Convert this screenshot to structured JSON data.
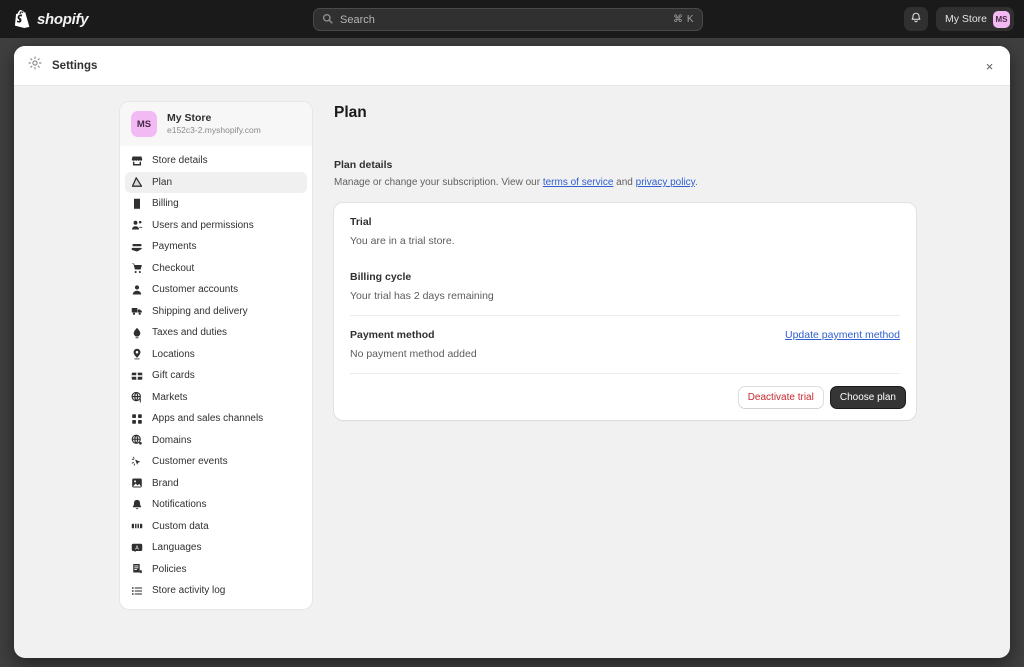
{
  "topbar": {
    "brand": "shopify",
    "brand_icon": "shopify-bag-icon",
    "search": {
      "placeholder": "Search",
      "icon": "search-icon",
      "shortcut": "⌘ K"
    },
    "notifications_icon": "bell-icon",
    "store_chip": {
      "name": "My Store",
      "avatar_initials": "MS"
    }
  },
  "modal": {
    "icon": "gear-icon",
    "title": "Settings",
    "close_label": "×"
  },
  "sidebar": {
    "store": {
      "avatar_initials": "MS",
      "name": "My Store",
      "domain": "e152c3-2.myshopify.com"
    },
    "items": [
      {
        "label": "Store details",
        "icon": "store-icon",
        "active": false
      },
      {
        "label": "Plan",
        "icon": "plan-chart-icon",
        "active": true
      },
      {
        "label": "Billing",
        "icon": "billing-receipt-icon",
        "active": false
      },
      {
        "label": "Users and permissions",
        "icon": "users-icon",
        "active": false
      },
      {
        "label": "Payments",
        "icon": "payments-hand-card-icon",
        "active": false
      },
      {
        "label": "Checkout",
        "icon": "cart-icon",
        "active": false
      },
      {
        "label": "Customer accounts",
        "icon": "person-icon",
        "active": false
      },
      {
        "label": "Shipping and delivery",
        "icon": "delivery-truck-icon",
        "active": false
      },
      {
        "label": "Taxes and duties",
        "icon": "taxes-icon",
        "active": false
      },
      {
        "label": "Locations",
        "icon": "location-pin-icon",
        "active": false
      },
      {
        "label": "Gift cards",
        "icon": "gift-card-icon",
        "active": false
      },
      {
        "label": "Markets",
        "icon": "globe-markets-icon",
        "active": false
      },
      {
        "label": "Apps and sales channels",
        "icon": "apps-grid-icon",
        "active": false
      },
      {
        "label": "Domains",
        "icon": "domains-globe-icon",
        "active": false
      },
      {
        "label": "Customer events",
        "icon": "cursor-events-icon",
        "active": false
      },
      {
        "label": "Brand",
        "icon": "brand-image-icon",
        "active": false
      },
      {
        "label": "Notifications",
        "icon": "bell-icon",
        "active": false
      },
      {
        "label": "Custom data",
        "icon": "custom-data-icon",
        "active": false
      },
      {
        "label": "Languages",
        "icon": "languages-icon",
        "active": false
      },
      {
        "label": "Policies",
        "icon": "policies-icon",
        "active": false
      },
      {
        "label": "Store activity log",
        "icon": "list-log-icon",
        "active": false
      }
    ]
  },
  "main": {
    "page_title": "Plan",
    "section": {
      "title": "Plan details",
      "description_prefix": "Manage or change your subscription. View our ",
      "link_terms": "terms of service",
      "description_mid": " and ",
      "link_privacy": "privacy policy",
      "description_suffix": "."
    },
    "card": {
      "trial_label": "Trial",
      "trial_value": "You are in a trial store.",
      "billing_cycle_label": "Billing cycle",
      "billing_cycle_value": "Your trial has 2 days remaining",
      "payment_method_label": "Payment method",
      "payment_method_value": "No payment method added",
      "update_payment_link": "Update payment method",
      "deactivate_button": "Deactivate trial",
      "choose_plan_button": "Choose plan"
    }
  },
  "colors": {
    "topbar_bg": "#1a1a1a",
    "accent_link": "#2f5fd0",
    "danger": "#c7282f",
    "avatar_bg": "#f2b9f2",
    "primary_button_bg": "#353535"
  }
}
